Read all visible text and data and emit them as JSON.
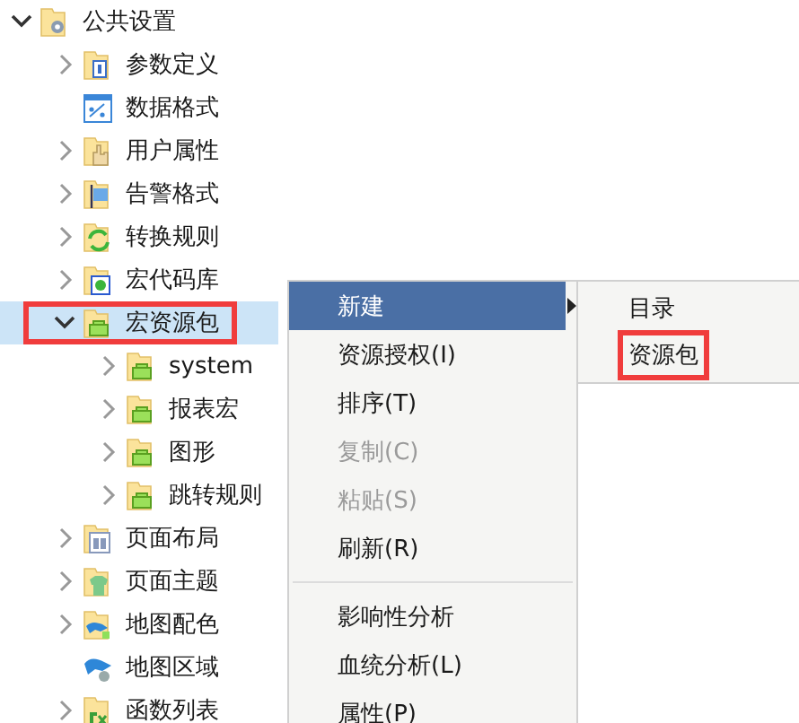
{
  "tree": [
    {
      "label": "公共设置",
      "expanded": true,
      "leaf": false,
      "selected": false,
      "annotated": false,
      "children": [
        {
          "label": "参数定义",
          "expanded": false,
          "leaf": false,
          "selected": false,
          "annotated": false
        },
        {
          "label": "数据格式",
          "leaf": true,
          "selected": false,
          "annotated": false
        },
        {
          "label": "用户属性",
          "expanded": false,
          "leaf": false,
          "selected": false,
          "annotated": false
        },
        {
          "label": "告警格式",
          "expanded": false,
          "leaf": false,
          "selected": false,
          "annotated": false
        },
        {
          "label": "转换规则",
          "expanded": false,
          "leaf": false,
          "selected": false,
          "annotated": false
        },
        {
          "label": "宏代码库",
          "expanded": false,
          "leaf": false,
          "selected": false,
          "annotated": false
        },
        {
          "label": "宏资源包",
          "expanded": true,
          "leaf": false,
          "selected": true,
          "annotated": true,
          "children": [
            {
              "label": "system",
              "expanded": false,
              "leaf": false,
              "selected": false,
              "annotated": false
            },
            {
              "label": "报表宏",
              "expanded": false,
              "leaf": false,
              "selected": false,
              "annotated": false
            },
            {
              "label": "图形",
              "expanded": false,
              "leaf": false,
              "selected": false,
              "annotated": false
            },
            {
              "label": "跳转规则",
              "expanded": false,
              "leaf": false,
              "selected": false,
              "annotated": false
            }
          ]
        },
        {
          "label": "页面布局",
          "expanded": false,
          "leaf": false,
          "selected": false,
          "annotated": false
        },
        {
          "label": "页面主题",
          "expanded": false,
          "leaf": false,
          "selected": false,
          "annotated": false
        },
        {
          "label": "地图配色",
          "expanded": false,
          "leaf": false,
          "selected": false,
          "annotated": false
        },
        {
          "label": "地图区域",
          "leaf": true,
          "selected": false,
          "annotated": false
        },
        {
          "label": "函数列表",
          "expanded": false,
          "leaf": false,
          "selected": false,
          "annotated": false
        }
      ]
    }
  ],
  "context_menu": [
    {
      "kind": "item",
      "label": "新建",
      "selected": true,
      "disabled": false,
      "submenu": true
    },
    {
      "kind": "item",
      "label": "资源授权(I)",
      "selected": false,
      "disabled": false,
      "submenu": false
    },
    {
      "kind": "item",
      "label": "排序(T)",
      "selected": false,
      "disabled": false,
      "submenu": false
    },
    {
      "kind": "item",
      "label": "复制(C)",
      "selected": false,
      "disabled": true,
      "submenu": false
    },
    {
      "kind": "item",
      "label": "粘贴(S)",
      "selected": false,
      "disabled": true,
      "submenu": false
    },
    {
      "kind": "item",
      "label": "刷新(R)",
      "selected": false,
      "disabled": false,
      "submenu": false
    },
    {
      "kind": "separator"
    },
    {
      "kind": "item",
      "label": "影响性分析",
      "selected": false,
      "disabled": false,
      "submenu": false
    },
    {
      "kind": "item",
      "label": "血统分析(L)",
      "selected": false,
      "disabled": false,
      "submenu": false
    },
    {
      "kind": "item",
      "label": "属性(P)",
      "selected": false,
      "disabled": false,
      "submenu": false
    }
  ],
  "submenu": [
    {
      "label": "目录",
      "annotated": false
    },
    {
      "label": "资源包",
      "annotated": true
    }
  ]
}
